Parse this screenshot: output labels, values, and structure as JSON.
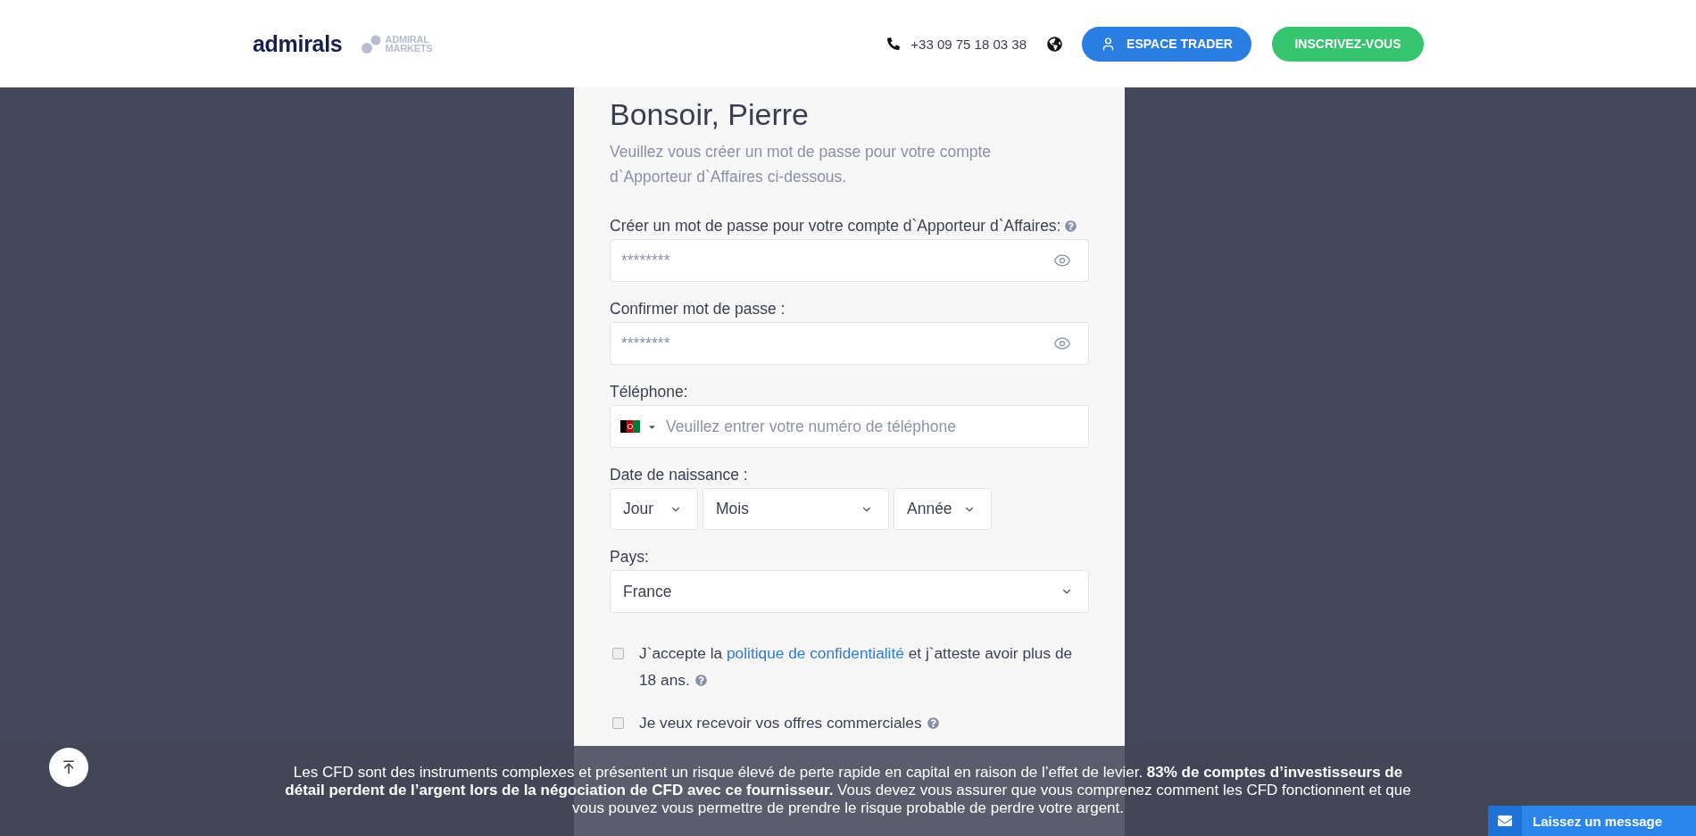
{
  "header": {
    "logo": "admirals",
    "partner_logo": "ADMIRAL MARKETS",
    "phone": "+33 09 75 18 03 38",
    "buttons": [
      {
        "label": "ESPACE TRADER",
        "kind": "trader"
      },
      {
        "label": "INSCRIVEZ-VOUS",
        "kind": "signup"
      }
    ]
  },
  "form": {
    "title": "Bonsoir, Pierre",
    "intro": "Veuillez vous créer un mot de passe pour votre compte d`Apporteur d`Affaires ci-dessous.",
    "fields": [
      {
        "kind": "password",
        "label": "Créer un mot de passe pour votre compte d`Apporteur d`Affaires:",
        "help": true,
        "placeholder": "********"
      },
      {
        "kind": "password",
        "label": "Confirmer mot de passe :",
        "help": false,
        "placeholder": "********"
      },
      {
        "kind": "phone",
        "label": "Téléphone:",
        "help": false,
        "placeholder": "Veuillez entrer votre numéro de téléphone"
      },
      {
        "kind": "date",
        "label": "Date de naissance :",
        "help": false,
        "options": [
          "Jour",
          "Mois",
          "Année"
        ]
      },
      {
        "kind": "select",
        "label": "Pays:",
        "help": false,
        "value": "France"
      }
    ],
    "consents": [
      {
        "parts": [
          {
            "kind": "text",
            "text": "J`accepte la "
          },
          {
            "kind": "link",
            "text": "politique de confidentialité"
          },
          {
            "kind": "text",
            "text": " et j`atteste avoir plus de 18 ans."
          }
        ],
        "checked": false,
        "help": true
      },
      {
        "parts": [
          {
            "kind": "text",
            "text": "Je veux recevoir vos offres commerciales"
          }
        ],
        "checked": false,
        "help": true
      }
    ]
  },
  "risk_warning": "Les CFD sont des instruments complexes et présentent un risque élevé de perte rapide en capital en raison de l’effet de levier. **83% de comptes d’investisseurs de détail perdent de l’argent lors de la négociation de CFD avec ce fournisseur.** Vous devez vous assurer que vous comprenez comment les CFD fonctionnent et que vous pouvez vous permettre de prendre le risque probable de perdre votre argent.",
  "chat_button": "Laissez un message"
}
